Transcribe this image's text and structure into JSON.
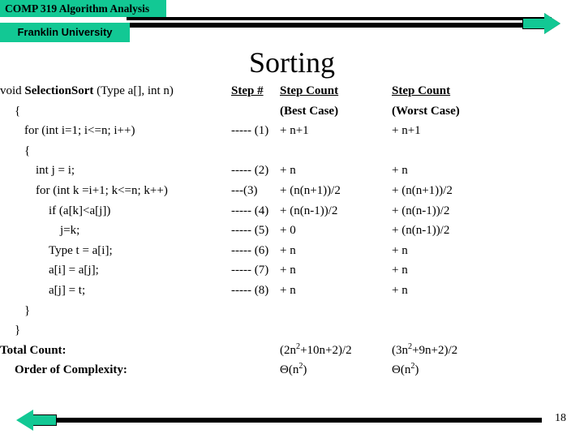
{
  "banner": {
    "course_label": "COMP 319  Algorithm Analysis",
    "university_label": "Franklin University",
    "accent_color": "#12C894",
    "rule_color": "#000000",
    "forward_arrow_icon": "arrow-right-icon"
  },
  "slide": {
    "title": "Sorting",
    "page_number": "18"
  },
  "headers": {
    "code_header": "",
    "step_number": "Step #",
    "best_case_title": "Step Count",
    "best_case_sub": "(Best Case)",
    "worst_case_title": "Step Count",
    "worst_case_sub": "(Worst Case)"
  },
  "code_rows": [
    {
      "code": "void SelectionSort (Type a[], int n)",
      "code_plain_prefix": "void ",
      "code_bold": "SelectionSort",
      "code_suffix": " (Type a[], int n)",
      "indent": 0,
      "step": "",
      "best": "",
      "worst": ""
    },
    {
      "code": "{",
      "indent": 1,
      "step": "",
      "best": "",
      "worst": ""
    },
    {
      "code": "for (int i=1; i<=n; i++)",
      "indent": 2,
      "step": "----- (1)",
      "best": "+ n+1",
      "worst": "+ n+1"
    },
    {
      "code": "{",
      "indent": 2,
      "step": "",
      "best": "",
      "worst": ""
    },
    {
      "code": "int j = i;",
      "indent": 3,
      "step": "----- (2)",
      "best": "+ n",
      "worst": "+ n"
    },
    {
      "code": "for (int k =i+1; k<=n; k++)",
      "indent": 3,
      "step": "---(3)",
      "best": "+ (n(n+1))/2",
      "worst": "+ (n(n+1))/2"
    },
    {
      "code": "if (a[k]<a[j])",
      "indent": 4,
      "step": "----- (4)",
      "best": "+ (n(n-1))/2",
      "worst": "+ (n(n-1))/2"
    },
    {
      "code": "j=k;",
      "indent": 5,
      "step": "----- (5)",
      "best": "+ 0",
      "worst": "+ (n(n-1))/2"
    },
    {
      "code": "Type t = a[i];",
      "indent": 4,
      "step": "----- (6)",
      "best": "+ n",
      "worst": "+ n"
    },
    {
      "code": "a[i] = a[j];",
      "indent": 4,
      "step": "----- (7)",
      "best": "+ n",
      "worst": "+ n"
    },
    {
      "code": "a[j] = t;",
      "indent": 4,
      "step": "----- (8)",
      "best": "+ n",
      "worst": "+ n"
    },
    {
      "code": "}",
      "indent": 2,
      "step": "",
      "best": "",
      "worst": ""
    },
    {
      "code": "}",
      "indent": 1,
      "step": "",
      "best": "",
      "worst": ""
    }
  ],
  "summary": {
    "total_count_label": "Total Count:",
    "total_count_best": "(2n2+10n+2)/2",
    "total_count_best_base": "(2n",
    "total_count_best_exp": "2",
    "total_count_best_tail": "+10n+2)/2",
    "total_count_worst_base": "(3n",
    "total_count_worst_exp": "2",
    "total_count_worst_tail": "+9n+2)/2",
    "complexity_label": "Order of Complexity:",
    "complexity_best_base": "Θ(n",
    "complexity_best_exp": "2",
    "complexity_best_tail": ")",
    "complexity_worst_base": "Θ(n",
    "complexity_worst_exp": "2",
    "complexity_worst_tail": ")"
  },
  "footer": {
    "back_arrow_icon": "arrow-left-icon"
  }
}
